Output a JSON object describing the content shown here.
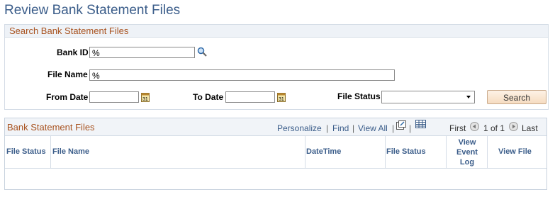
{
  "page_title": "Review Bank Statement Files",
  "search": {
    "header": "Search Bank Statement Files",
    "bank_id_label": "Bank ID",
    "bank_id_value": "%",
    "file_name_label": "File Name",
    "file_name_value": "%",
    "from_date_label": "From Date",
    "from_date_value": "",
    "to_date_label": "To Date",
    "to_date_value": "",
    "file_status_label": "File Status",
    "file_status_value": "",
    "search_button": "Search"
  },
  "grid": {
    "title": "Bank Statement Files",
    "personalize": "Personalize",
    "find": "Find",
    "view_all": "View All",
    "first": "First",
    "page_info": "1 of 1",
    "last": "Last",
    "columns": [
      "File Status",
      "File Name",
      "DateTime",
      "File Status",
      "View Event Log",
      "View File"
    ],
    "rows": []
  },
  "colors": {
    "title": "#3b5d8a",
    "section_header": "#a8521f",
    "link": "#3b5d8a"
  }
}
